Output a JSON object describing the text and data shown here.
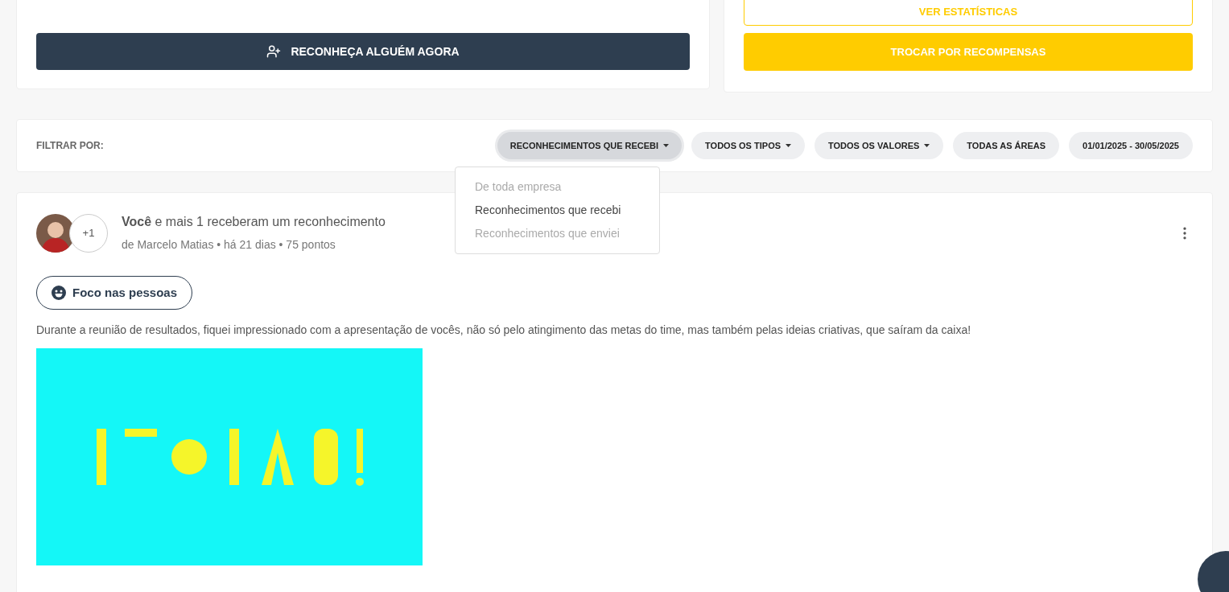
{
  "top_left_card": {
    "button": "RECONHEÇA ALGUÉM AGORA"
  },
  "top_right_card": {
    "buttons": [
      {
        "label": "VER ESTATÍSTICAS",
        "kind": "outline"
      },
      {
        "label": "TROCAR POR RECOMPENSAS",
        "kind": "solid"
      }
    ]
  },
  "filter_bar": {
    "label": "FILTRAR POR:",
    "filters": [
      {
        "label": "RECONHECIMENTOS QUE RECEBI",
        "dropdown": true,
        "selected": true
      },
      {
        "label": "TODOS OS TIPOS",
        "dropdown": true,
        "selected": false
      },
      {
        "label": "TODOS OS VALORES",
        "dropdown": true,
        "selected": false
      },
      {
        "label": "TODAS AS ÁREAS",
        "dropdown": false,
        "selected": false
      },
      {
        "label": "01/01/2025 - 30/05/2025",
        "dropdown": false,
        "selected": false
      }
    ]
  },
  "dropdown_menu": {
    "options": [
      {
        "label": "De toda empresa",
        "selected": false
      },
      {
        "label": "Reconhecimentos que recebi",
        "selected": true
      },
      {
        "label": "Reconhecimentos que enviei",
        "selected": false
      }
    ]
  },
  "post": {
    "extra_count": "+1",
    "headline": "**Você** e mais 1 receberam um reconhecimento",
    "meta": "de Marcelo Matias • há 21 dias • 75 pontos",
    "tag": "Foco nas pessoas",
    "message": "Durante a reunião de resultados, fiquei impressionado com a apresentação de vocês, não só pelo atingimento das metas do time, mas também pelas ideias criativas, que saíram da caixa!"
  }
}
